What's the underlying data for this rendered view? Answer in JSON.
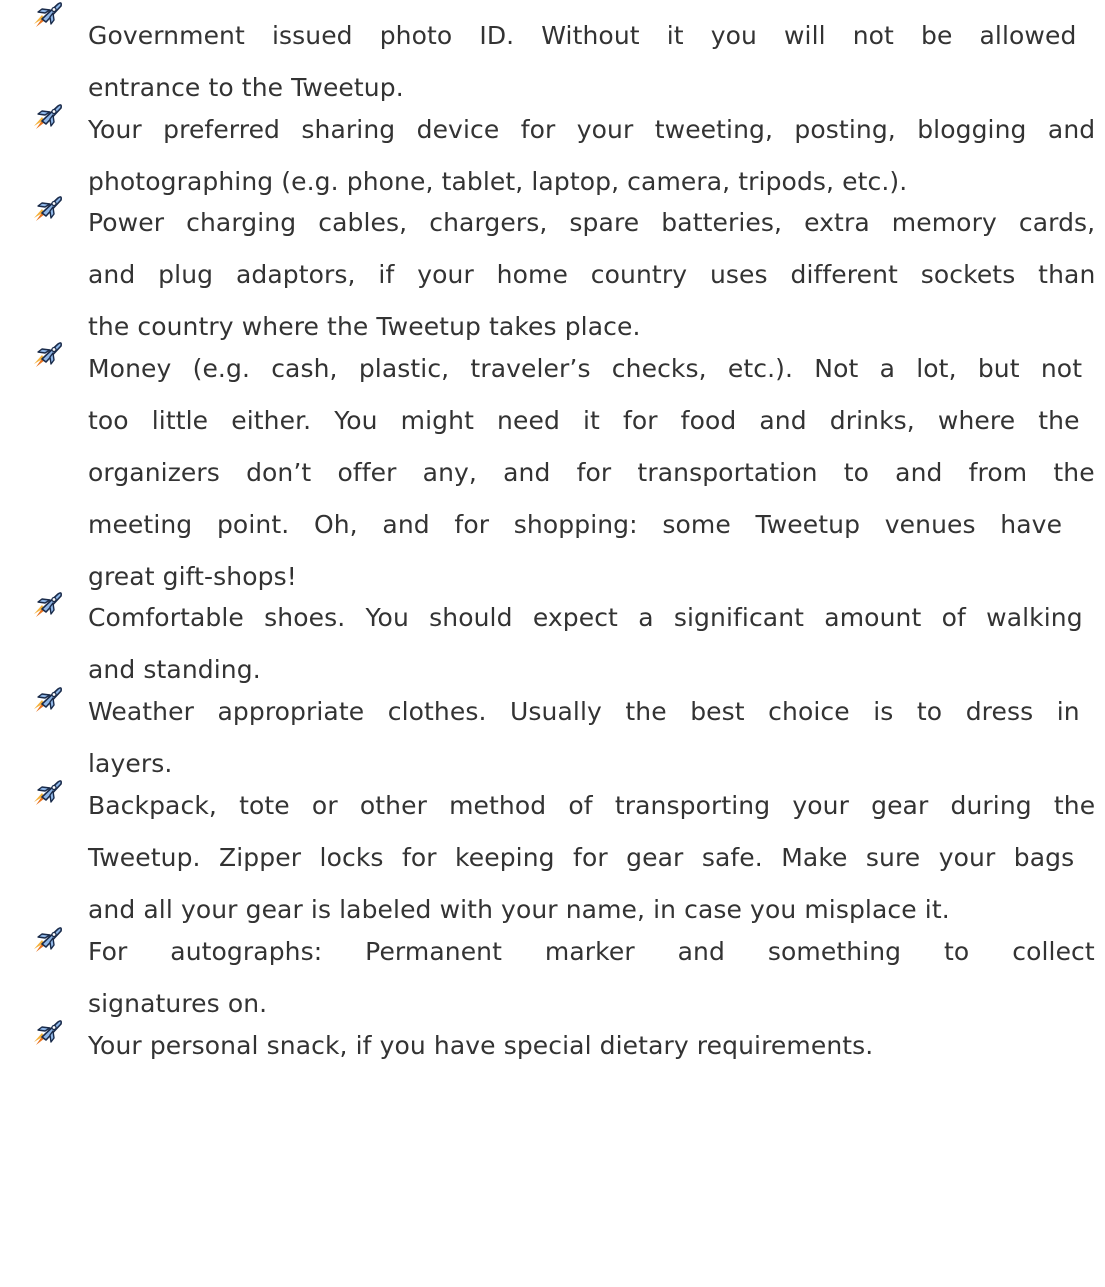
{
  "bullet_icon": "rocket-icon",
  "colors": {
    "text": "#333333",
    "rocket_body": "#8fb7e8",
    "rocket_outline": "#1a2b4a",
    "rocket_flame": "#e8731f"
  },
  "items": [
    {
      "lines": [
        "Government issued photo ID.  Without it you will not be allowed",
        "entrance to the Tweetup."
      ]
    },
    {
      "lines": [
        "Your preferred sharing device for your tweeting, posting, blogging and",
        "photographing (e.g. phone, tablet, laptop, camera, tripods, etc.)."
      ]
    },
    {
      "lines": [
        "Power charging cables, chargers, spare batteries, extra memory cards,",
        "and plug adaptors, if your home country uses different sockets than",
        "the country where the Tweetup takes place."
      ]
    },
    {
      "lines": [
        "Money (e.g. cash, plastic, traveler’s checks, etc.).  Not a lot, but not",
        "too little either.  You might need it for food and drinks, where the",
        "organizers don’t offer any, and for transportation to and from the",
        "meeting point.  Oh, and for shopping:  some Tweetup venues have",
        "great gift-shops!"
      ]
    },
    {
      "lines": [
        "Comfortable shoes.  You should expect a significant amount of walking",
        "and standing."
      ]
    },
    {
      "lines": [
        "Weather appropriate clothes.  Usually the best choice is to dress in",
        "layers."
      ]
    },
    {
      "lines": [
        "Backpack, tote or other method of transporting your gear during the",
        "Tweetup.  Zipper locks for keeping for gear safe.  Make sure your bags",
        "and all your gear is labeled with your name, in case you misplace it."
      ]
    },
    {
      "lines": [
        "For autographs: Permanent marker and something to collect",
        "signatures on."
      ]
    },
    {
      "lines": [
        "Your personal snack, if you have special dietary requirements."
      ]
    }
  ]
}
